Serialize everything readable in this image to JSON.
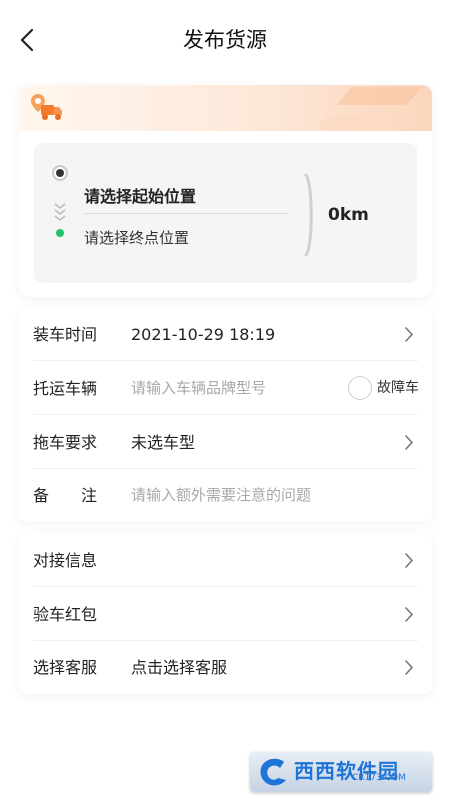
{
  "header": {
    "title": "发布货源"
  },
  "route": {
    "start_label": "请选择起始位置",
    "end_label": "请选择终点位置",
    "distance": "0km",
    "colors": {
      "accent": "#f47a2e",
      "end_dot": "#24c06c"
    }
  },
  "form": {
    "load_time": {
      "label": "装车时间",
      "value": "2021-10-29 18:19"
    },
    "vehicle": {
      "label": "托运车辆",
      "placeholder": "请输入车辆品牌型号",
      "fault_label": "故障车"
    },
    "tow_req": {
      "label": "拖车要求",
      "value": "未选车型"
    },
    "remark": {
      "label": "备　　注",
      "placeholder": "请输入额外需要注意的问题"
    }
  },
  "extra": {
    "contact": {
      "label": "对接信息"
    },
    "red_packet": {
      "label": "验车红包"
    },
    "service": {
      "label": "选择客服",
      "value": "点击选择客服"
    }
  },
  "watermark": {
    "main": "西西软件园",
    "sub": "CR173.COM"
  },
  "icons": [
    "back-arrow-icon",
    "truck-location-icon",
    "start-dot-icon",
    "double-chevron-down-icon",
    "end-dot-icon",
    "chevron-right-icon",
    "radio-icon"
  ]
}
